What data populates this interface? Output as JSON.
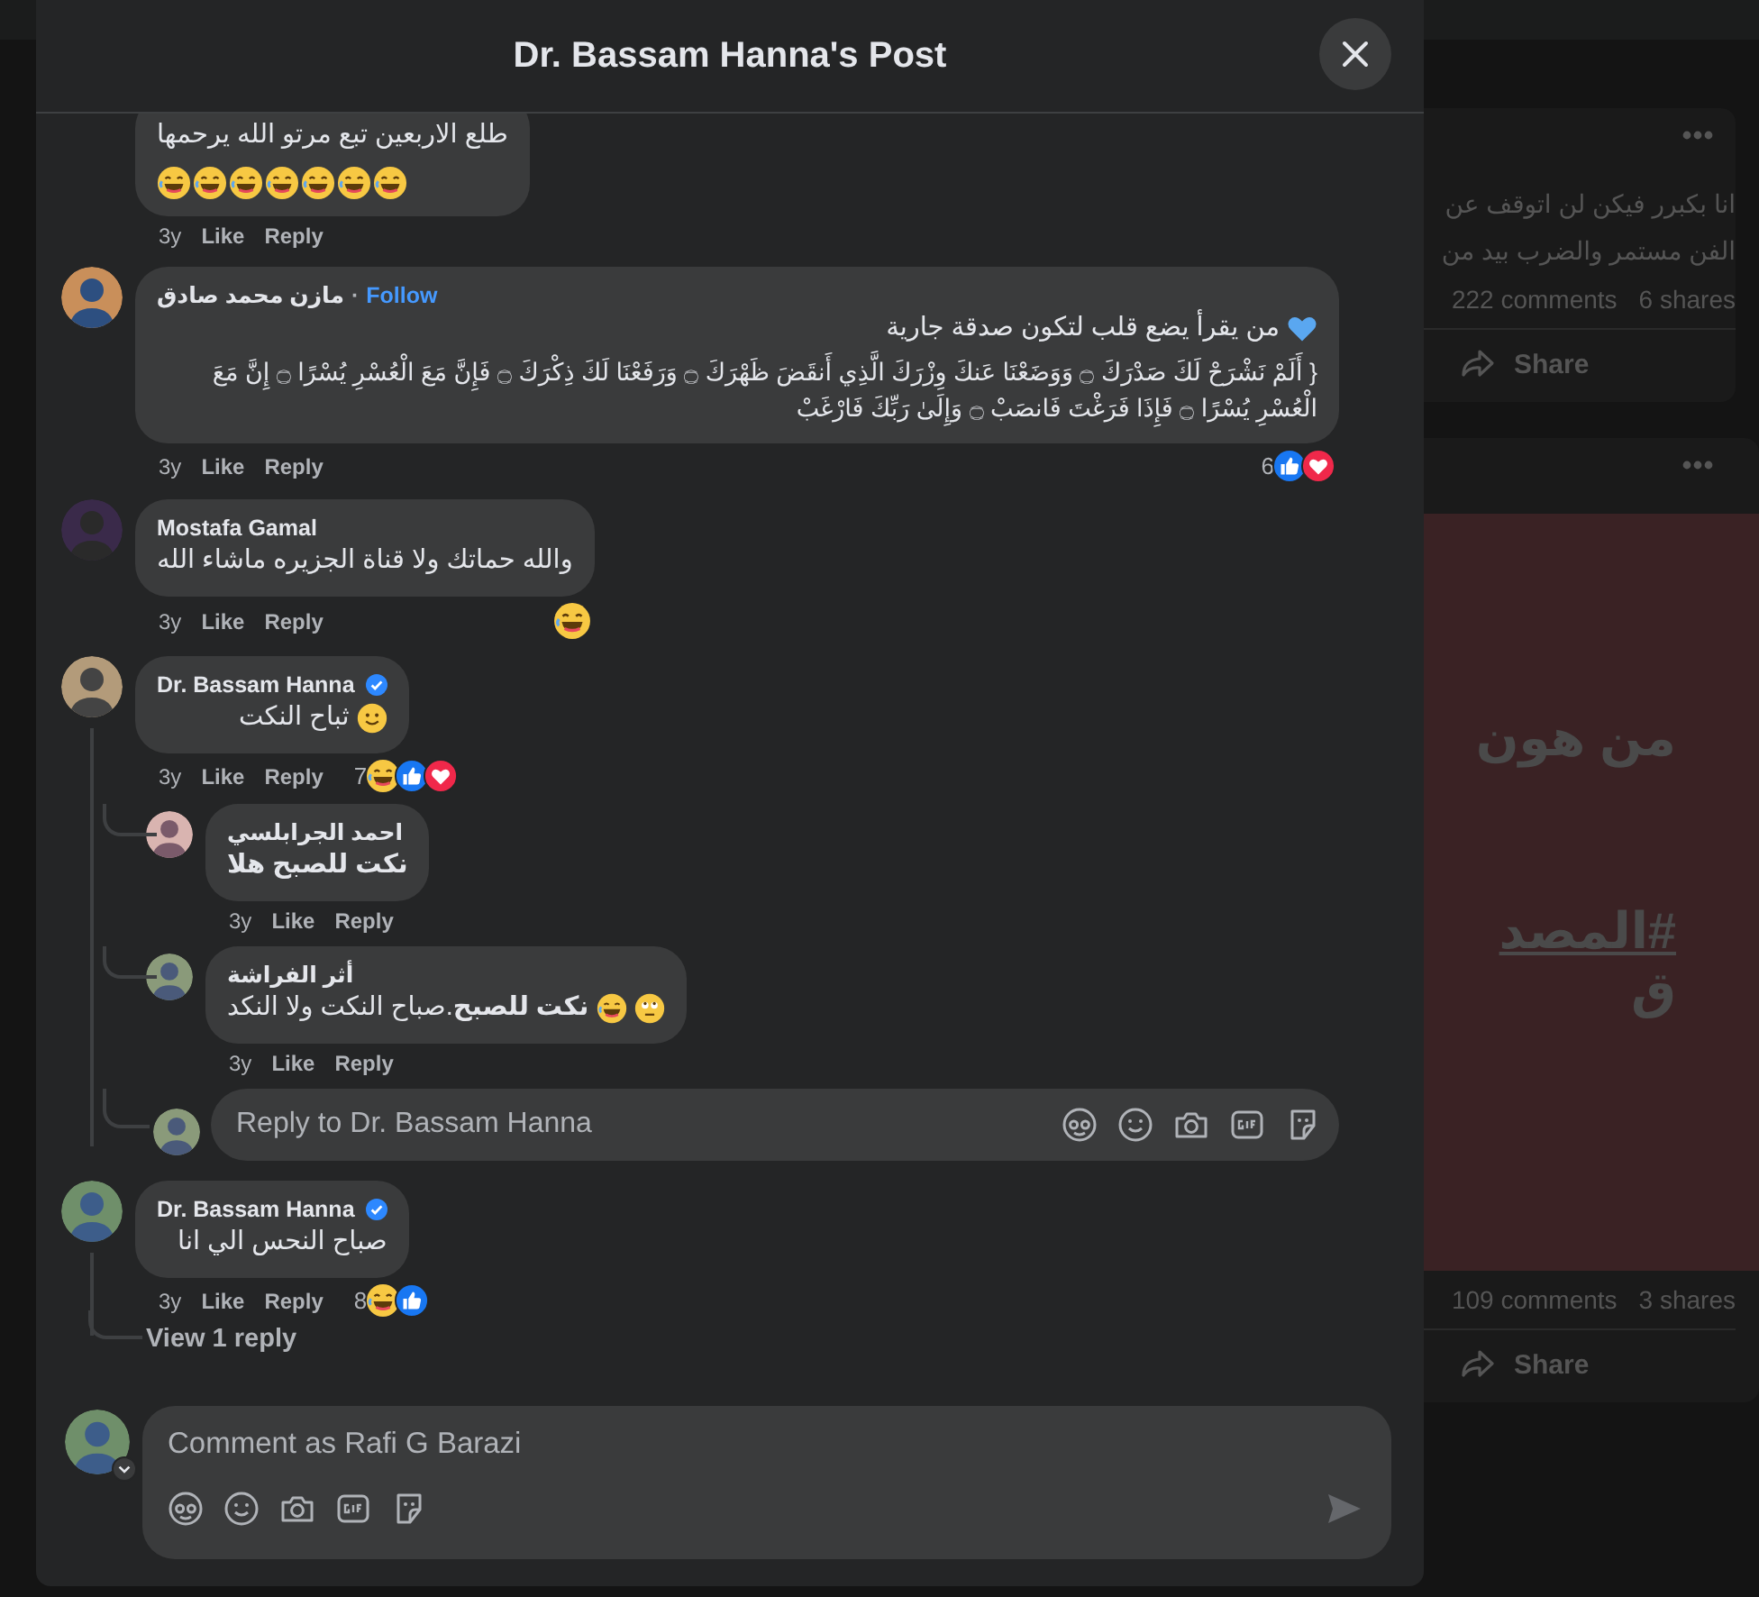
{
  "background_feed": {
    "posts": [
      {
        "text_lines": [
          "انا بكبرر فيكن لن اتوقف عن",
          "الفن مستمر والضرب بيد من"
        ],
        "comments": "222 comments",
        "shares": "6 shares",
        "share_label": "Share"
      },
      {
        "picture_texts": [
          "من هون",
          "#المصد",
          "ق"
        ],
        "comments": "109 comments",
        "shares": "3 shares",
        "share_label": "Share"
      }
    ]
  },
  "dialog": {
    "title": "Dr. Bassam Hanna's Post",
    "comments": [
      {
        "text_lines": [
          "طلع الاربعين تبع مرتو الله يرحمها"
        ],
        "emojis": [
          {
            "kind": "haha"
          },
          {
            "kind": "haha"
          },
          {
            "kind": "haha"
          },
          {
            "kind": "haha"
          },
          {
            "kind": "haha"
          },
          {
            "kind": "haha"
          },
          {
            "kind": "haha"
          }
        ],
        "time": "3y",
        "like": "Like",
        "reply": "Reply"
      },
      {
        "author": "مازن محمد صادق",
        "separator": "·",
        "follow": "Follow",
        "text_lines": [
          "من يقرأ يضع قلب لتكون صدقة جارية"
        ],
        "line_emojis": [
          {
            "kind": "blue-heart"
          }
        ],
        "quote": "{ أَلَمْ نَشْرَحْ لَكَ صَدْرَكَ ۝ وَوَضَعْنَا عَنكَ وِزْرَكَ الَّذِي أَنقَضَ ظَهْرَكَ ۝ وَرَفَعْنَا لَكَ ذِكْرَكَ ۝ فَإِنَّ مَعَ الْعُسْرِ يُسْرًا ۝ إِنَّ مَعَ الْعُسْرِ يُسْرًا ۝ فَإِذَا فَرَغْتَ فَانصَبْ ۝ وَإِلَىٰ رَبِّكَ فَارْغَبْ",
        "time": "3y",
        "like": "Like",
        "reply": "Reply",
        "reaction_count": "6",
        "reactions": [
          {
            "kind": "like"
          },
          {
            "kind": "love"
          }
        ]
      },
      {
        "author": "Mostafa Gamal",
        "text_lines": [
          "والله حماتك ولا قناة الجزيره ماشاء الله"
        ],
        "time": "3y",
        "like": "Like",
        "reply": "Reply",
        "reactions": [
          {
            "kind": "haha"
          }
        ]
      },
      {
        "author": "Dr. Bassam Hanna",
        "verified": true,
        "text_lines": [
          "ثباح النكت"
        ],
        "line_emojis": [
          {
            "kind": "smile"
          }
        ],
        "time": "3y",
        "like": "Like",
        "reply": "Reply",
        "reaction_count": "7",
        "reactions": [
          {
            "kind": "haha"
          },
          {
            "kind": "like"
          },
          {
            "kind": "love"
          }
        ],
        "children": [
          {
            "author": "احمد الجرابلسي",
            "text_lines": [
              "نكت للصبح هلا"
            ],
            "bold": true,
            "time": "3y",
            "like": "Like",
            "reply": "Reply"
          },
          {
            "author": "أثر الفراشة",
            "text_lines": [
              "**نكت للصبح**.صباح النكت ولا النكد"
            ],
            "line_emojis": [
              {
                "kind": "eye-roll"
              },
              {
                "kind": "haha"
              }
            ],
            "time": "3y",
            "like": "Like",
            "reply": "Reply"
          }
        ],
        "reply_box": {
          "placeholder": "Reply to Dr. Bassam Hanna"
        }
      },
      {
        "author": "Dr. Bassam Hanna",
        "verified": true,
        "text_lines": [
          "صباح النحس الي انا"
        ],
        "time": "3y",
        "like": "Like",
        "reply": "Reply",
        "reaction_count": "8",
        "reactions": [
          {
            "kind": "haha"
          },
          {
            "kind": "like"
          }
        ],
        "view_replies": "View 1 reply"
      }
    ],
    "composer": {
      "placeholder": "Comment as Rafi G Barazi"
    }
  }
}
